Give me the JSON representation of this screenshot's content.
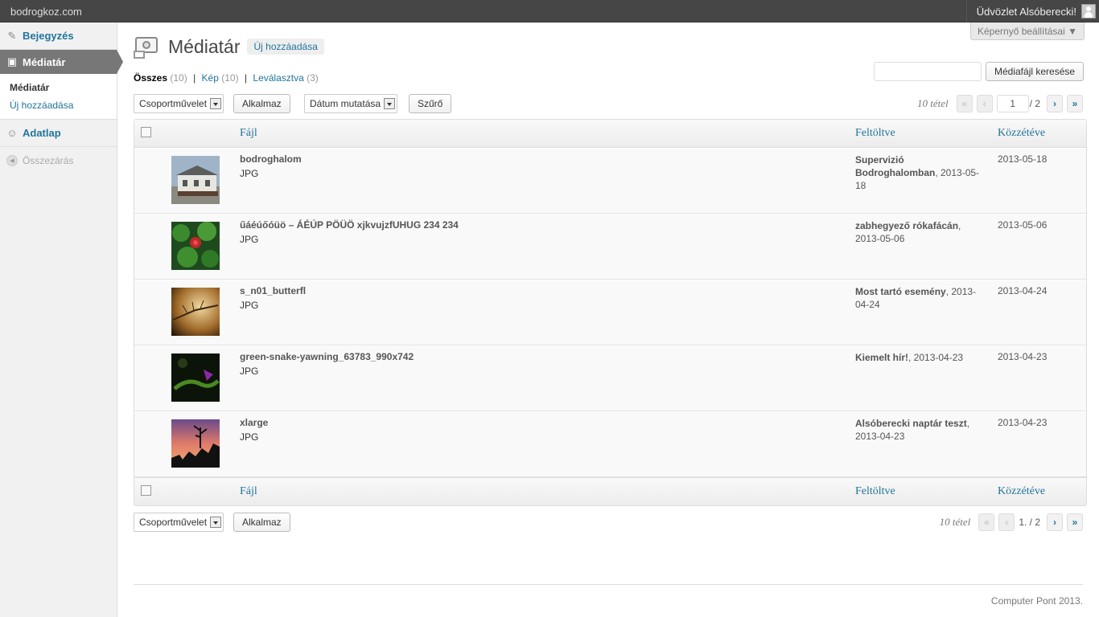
{
  "adminbar": {
    "site": "bodrogkoz.com",
    "howdy": "Üdvözlet Alsóberecki!"
  },
  "sidebar": {
    "items": [
      {
        "label": "Bejegyzés",
        "icon": "pin-icon"
      },
      {
        "label": "Médiatár",
        "icon": "media-icon"
      },
      {
        "label": "Adatlap",
        "icon": "users-icon"
      }
    ],
    "submenu": [
      {
        "label": "Médiatár"
      },
      {
        "label": "Új hozzáadása"
      }
    ],
    "collapse": "Összezárás"
  },
  "header": {
    "screen_options": "Képernyő beállításai ▼",
    "title": "Médiatár",
    "add_new": "Új hozzáadása"
  },
  "views": [
    {
      "label": "Összes",
      "count": "(10)"
    },
    {
      "label": "Kép",
      "count": "(10)"
    },
    {
      "label": "Leválasztva",
      "count": "(3)"
    }
  ],
  "search": {
    "button": "Médiafájl keresése",
    "value": ""
  },
  "tablenav": {
    "bulk": "Csoportművelet",
    "apply": "Alkalmaz",
    "date_filter": "Dátum mutatása",
    "filter": "Szűrő",
    "count": "10 tétel",
    "first": "«",
    "prev": "‹",
    "next": "›",
    "last": "»",
    "page": "1",
    "total": "/ 2",
    "page_bottom": "1. / 2"
  },
  "table": {
    "columns": {
      "file": "Fájl",
      "uploaded": "Feltöltve",
      "published": "Közzétéve"
    },
    "rows": [
      {
        "name": "bodroghalom",
        "type": "JPG",
        "post": "Supervizió Bodroghalomban",
        "post_date": ", 2013-05-18",
        "date": "2013-05-18"
      },
      {
        "name": "űáéúőóüö – ÁÉÚP PÖÜÖ xjkvujzfUHUG 234 234",
        "type": "JPG",
        "post": "zabhegyező rókafácán",
        "post_date": ", 2013-05-06",
        "date": "2013-05-06"
      },
      {
        "name": "s_n01_butterfl",
        "type": "JPG",
        "post": "Most tartó esemény",
        "post_date": ", 2013-04-24",
        "date": "2013-04-24"
      },
      {
        "name": "green-snake-yawning_63783_990x742",
        "type": "JPG",
        "post": "Kiemelt hír!",
        "post_date": ", 2013-04-23",
        "date": "2013-04-23"
      },
      {
        "name": "xlarge",
        "type": "JPG",
        "post": "Alsóberecki naptár teszt",
        "post_date": ", 2013-04-23",
        "date": "2013-04-23"
      }
    ]
  },
  "footer": {
    "text": "Computer Pont 2013."
  },
  "colors": {
    "link": "#21759b",
    "adminbar": "#464646",
    "current_menu": "#777777"
  }
}
